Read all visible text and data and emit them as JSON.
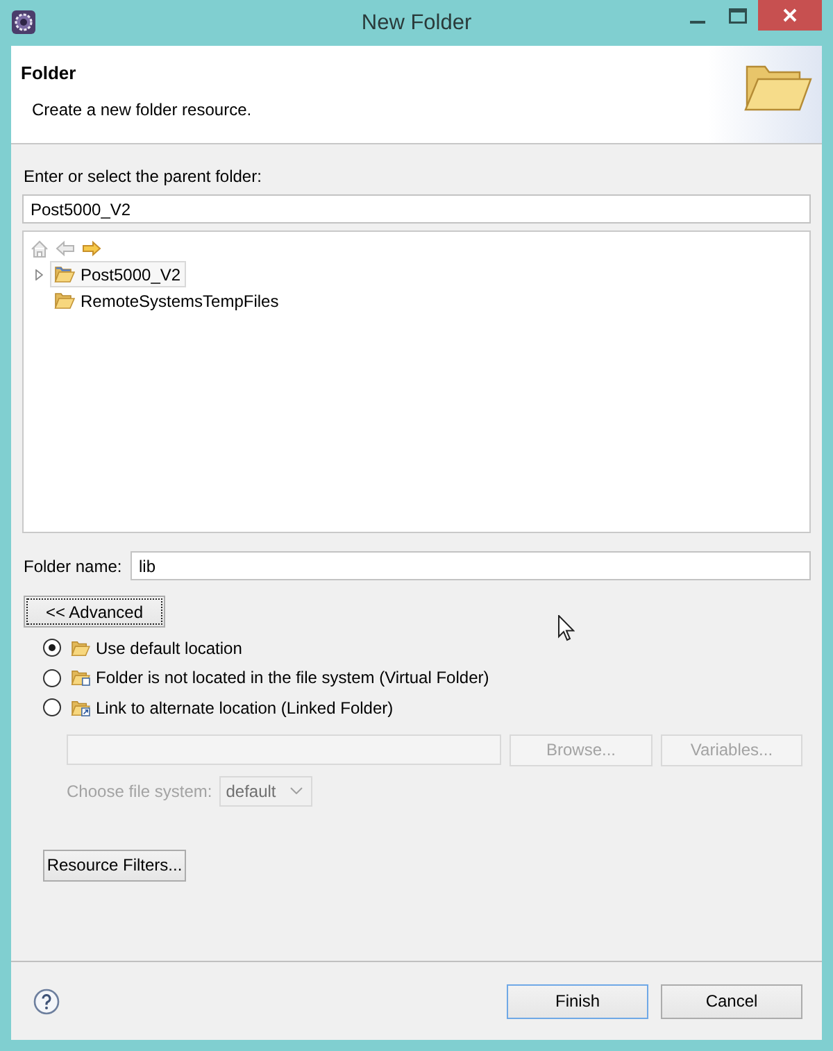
{
  "window": {
    "title": "New Folder"
  },
  "header": {
    "title": "Folder",
    "description": "Create a new folder resource."
  },
  "parent_folder": {
    "label": "Enter or select the parent folder:",
    "value": "Post5000_V2"
  },
  "tree": {
    "toolbar": [
      {
        "kind": "home",
        "disabled": true
      },
      {
        "kind": "back",
        "disabled": true
      },
      {
        "kind": "forward",
        "disabled": false
      }
    ],
    "items": [
      {
        "kind": "project",
        "label": "Post5000_V2",
        "selected": true,
        "expandable": true,
        "expanded": false
      },
      {
        "kind": "folder",
        "label": "RemoteSystemsTempFiles",
        "selected": false,
        "expandable": false
      }
    ]
  },
  "folder_name": {
    "label": "Folder name:",
    "value": "lib"
  },
  "advanced_button": {
    "label": "<< Advanced",
    "focused": true
  },
  "location_options": [
    {
      "kind": "default",
      "label": "Use default location",
      "selected": true
    },
    {
      "kind": "virtual",
      "label": "Folder is not located in the file system (Virtual Folder)",
      "selected": false
    },
    {
      "kind": "linked",
      "label": "Link to alternate location (Linked Folder)",
      "selected": false
    }
  ],
  "link_location": {
    "disabled": true,
    "buttons": [
      {
        "label": "Browse...",
        "disabled": true
      },
      {
        "label": "Variables...",
        "disabled": true
      }
    ]
  },
  "file_system": {
    "label": "Choose file system:",
    "value": "default",
    "disabled": true
  },
  "resource_filters_button": {
    "label": "Resource Filters..."
  },
  "footer": {
    "buttons": [
      {
        "label": "Finish",
        "default": true
      },
      {
        "label": "Cancel",
        "default": false
      }
    ]
  }
}
